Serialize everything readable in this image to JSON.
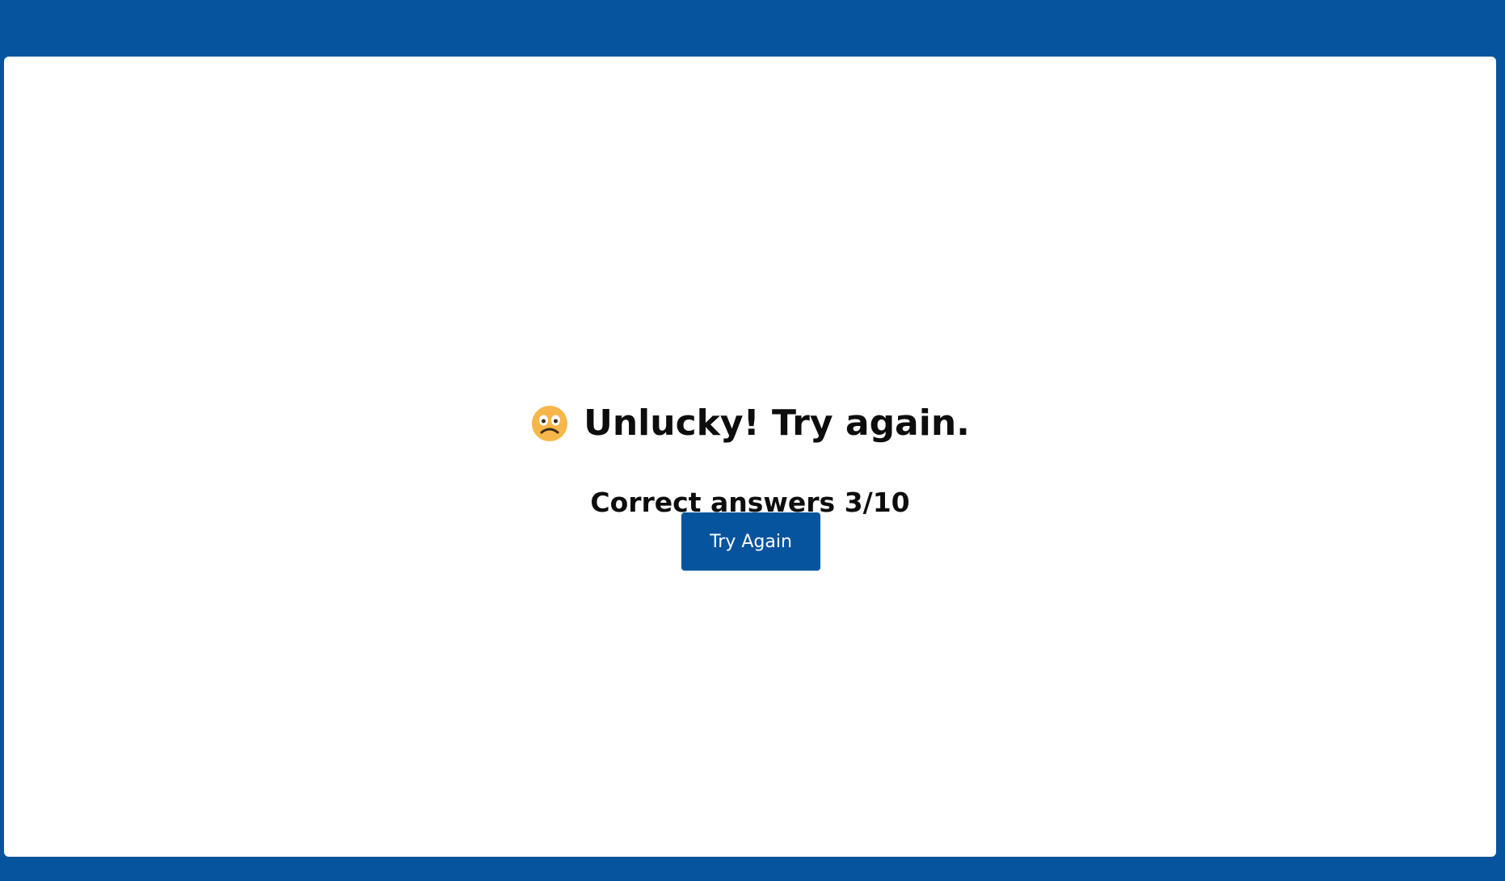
{
  "result": {
    "title": "Unlucky! Try again.",
    "score_text": "Correct answers 3/10",
    "icon": "frowning-face-icon"
  },
  "actions": {
    "try_again_label": "Try Again"
  },
  "colors": {
    "frame_blue": "#07549e",
    "card_white": "#ffffff",
    "text_dark": "#0d0d0d",
    "emoji_yellow": "#f7b64a"
  }
}
